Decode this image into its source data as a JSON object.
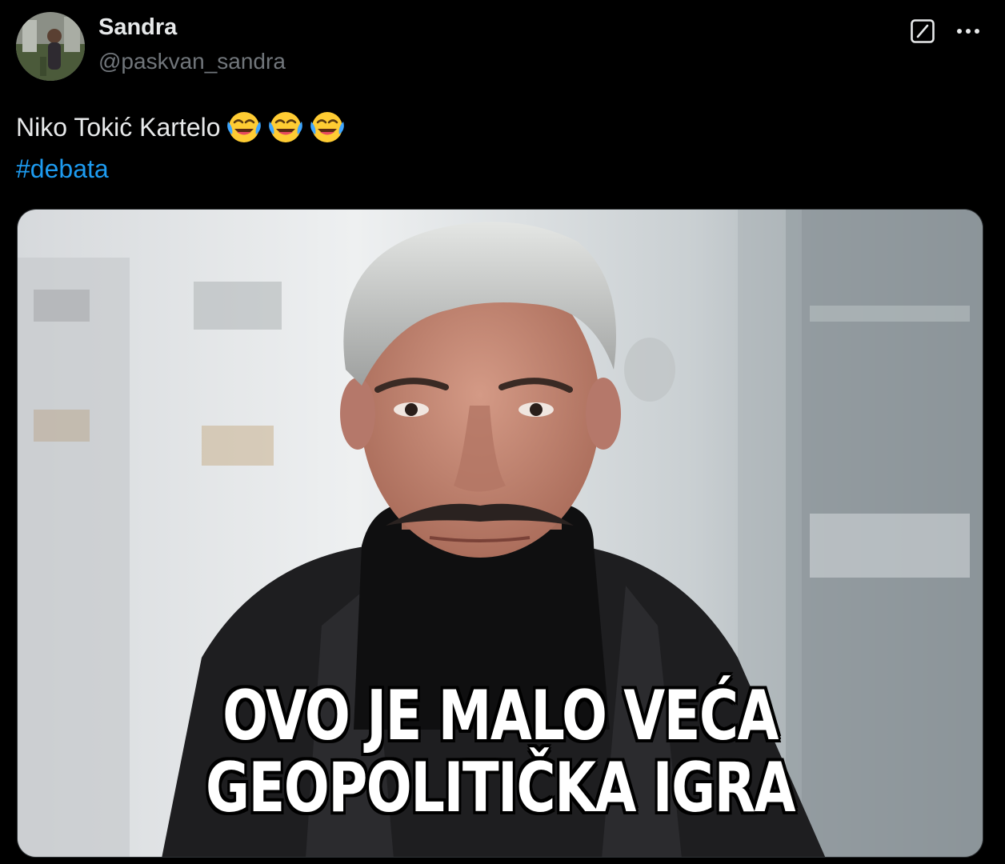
{
  "author": {
    "display_name": "Sandra",
    "handle": "@paskvan_sandra"
  },
  "icons": {
    "avatar": "avatar-photo",
    "grok": "grok-icon",
    "more": "more-horizontal-icon",
    "emoji": "face-with-tears-of-joy-emoji"
  },
  "tweet": {
    "text": "Niko Tokić Kartelo",
    "emoji_count": 3,
    "hashtag": "#debata"
  },
  "media": {
    "caption_line1": "OVO JE MALO VEĆA",
    "caption_line2": "GEOPOLITIČKA IGRA"
  },
  "colors": {
    "background": "#000000",
    "text_primary": "#e7e9ea",
    "text_secondary": "#71767b",
    "link": "#1d9bf0"
  }
}
